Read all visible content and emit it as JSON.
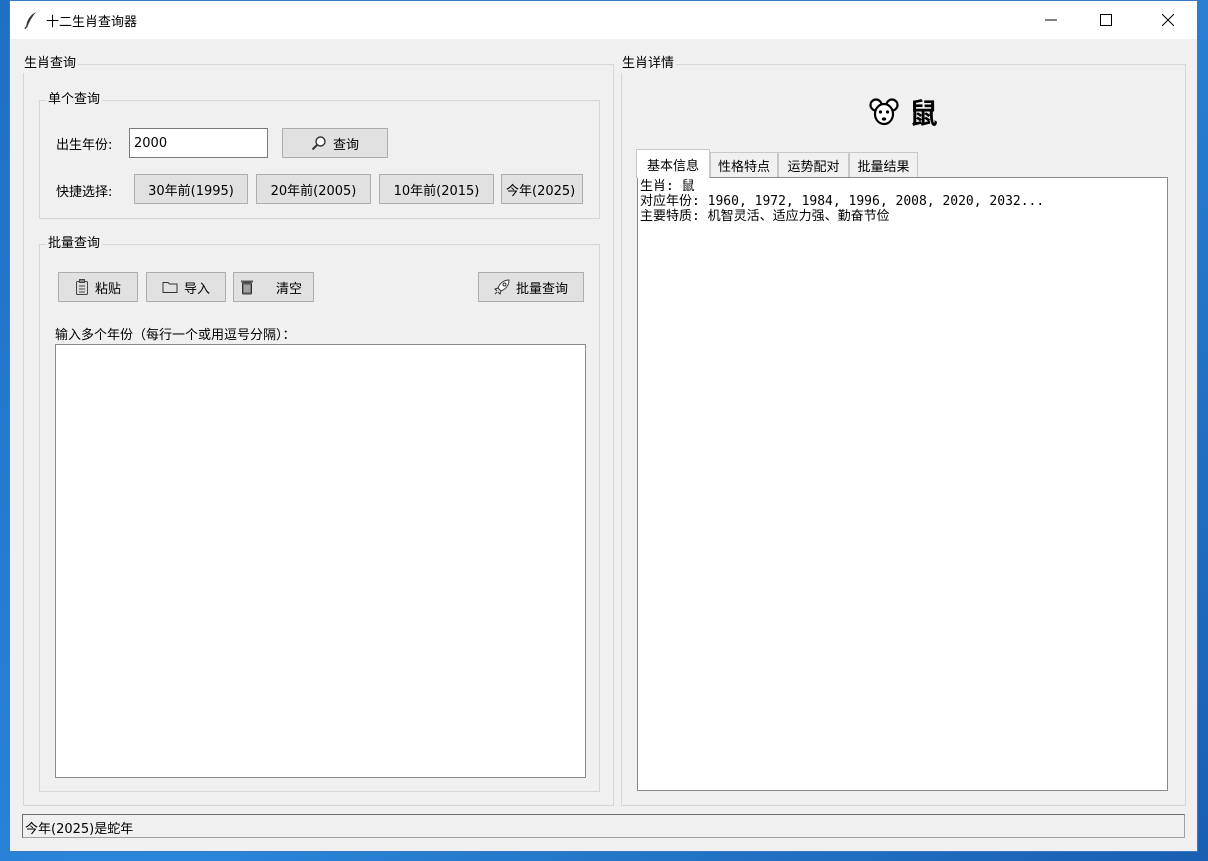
{
  "window": {
    "title": "十二生肖查询器"
  },
  "query_panel": {
    "title": "生肖查询",
    "single": {
      "title": "单个查询",
      "year_label": "出生年份:",
      "year_value": "2000",
      "query_button": "查询",
      "quick_label": "快捷选择:",
      "quick_buttons": [
        "30年前(1995)",
        "20年前(2005)",
        "10年前(2015)",
        "今年(2025)"
      ]
    },
    "batch": {
      "title": "批量查询",
      "paste_button": "粘贴",
      "import_button": "导入",
      "clear_button": "清空",
      "batch_query_button": "批量查询",
      "input_label": "输入多个年份（每行一个或用逗号分隔）：",
      "input_value": ""
    }
  },
  "detail_panel": {
    "title": "生肖详情",
    "zodiac_name": "鼠",
    "tabs": [
      "基本信息",
      "性格特点",
      "运势配对",
      "批量结果"
    ],
    "active_tab": "基本信息",
    "content": {
      "line1": "生肖: 鼠",
      "line2": "对应年份: 1960, 1972, 1984, 1996, 2008, 2020, 2032...",
      "line3": "主要特质: 机智灵活、适应力强、勤奋节俭"
    }
  },
  "status": {
    "text": "今年(2025)是蛇年"
  },
  "icons": {
    "title": "feather-icon",
    "query": "magnifier-icon",
    "paste": "clipboard-icon",
    "import": "folder-icon",
    "clear": "trash-icon",
    "batch": "rocket-icon",
    "zodiac": "mouse-face-icon"
  }
}
